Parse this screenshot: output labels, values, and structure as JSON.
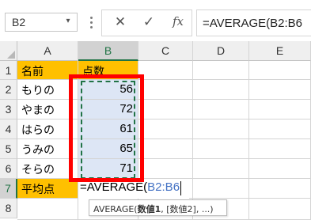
{
  "formula_bar": {
    "name_box": "B2",
    "name_box_arrow": "▾",
    "cancel_glyph": "✕",
    "enter_glyph": "✓",
    "fx_glyph": "fx",
    "formula": "=AVERAGE(B2:B6"
  },
  "columns": [
    "A",
    "B",
    "C",
    "D",
    "E"
  ],
  "rows": [
    "1",
    "2",
    "3",
    "4",
    "5",
    "6",
    "7",
    "8"
  ],
  "selected_column": "B",
  "selected_row": "7",
  "sheet": {
    "header": {
      "name": "名前",
      "score": "点数"
    },
    "names": [
      "もりの",
      "やまの",
      "はらの",
      "うみの",
      "そらの"
    ],
    "scores": [
      "56",
      "72",
      "61",
      "65",
      "71"
    ],
    "avg_label": "平均点",
    "edit_prefix": "=AVERAGE(",
    "edit_ref": "B2:B6"
  },
  "tooltip": {
    "fn": "AVERAGE(",
    "arg1": "数値1",
    "rest": ", [数値2], ...)"
  },
  "colors": {
    "header_fill": "#ffc000",
    "range_fill": "#dde6f5",
    "range_border": "#217346",
    "annotation": "#ff0000",
    "ref_text": "#4472c4"
  }
}
